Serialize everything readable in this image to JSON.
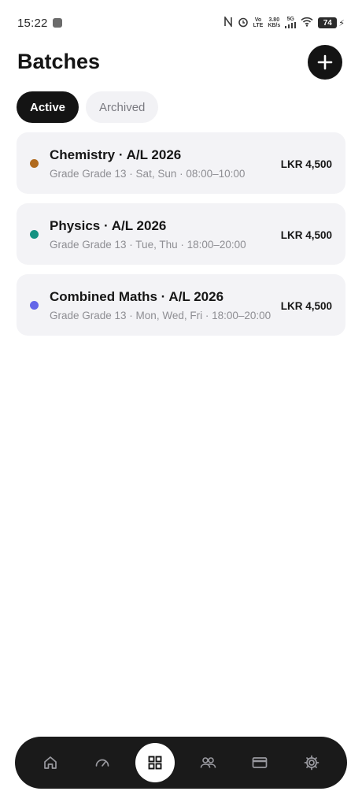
{
  "status_bar": {
    "time": "15:22",
    "volte_label": "Vo",
    "lte_label": "LTE",
    "speed_value": "3.80",
    "speed_unit": "KB/s",
    "network_label": "5G",
    "battery_level": "74"
  },
  "header": {
    "title": "Batches",
    "add_icon": "plus-icon"
  },
  "tabs": [
    {
      "label": "Active",
      "selected": true
    },
    {
      "label": "Archived",
      "selected": false
    }
  ],
  "batches": [
    {
      "title": "Chemistry · A/L 2026",
      "subtitle": "Grade Grade 13 · Sat, Sun · 08:00–10:00",
      "fee": "LKR 4,500",
      "dot_color": "#b06a1e"
    },
    {
      "title": "Physics · A/L 2026",
      "subtitle": "Grade Grade 13 · Tue, Thu · 18:00–20:00",
      "fee": "LKR 4,500",
      "dot_color": "#149181"
    },
    {
      "title": "Combined Maths · A/L 2026",
      "subtitle": "Grade Grade 13 · Mon, Wed, Fri · 18:00–20:00",
      "fee": "LKR 4,500",
      "dot_color": "#6366e8"
    }
  ],
  "bottom_nav": [
    {
      "icon": "home-icon",
      "active": false
    },
    {
      "icon": "dashboard-gauge-icon",
      "active": false
    },
    {
      "icon": "grid-icon",
      "active": true
    },
    {
      "icon": "people-icon",
      "active": false
    },
    {
      "icon": "card-icon",
      "active": false
    },
    {
      "icon": "gear-icon",
      "active": false
    }
  ],
  "colors": {
    "primary": "#141414",
    "card_background": "#f3f3f6",
    "muted_text": "#8e8e93"
  }
}
